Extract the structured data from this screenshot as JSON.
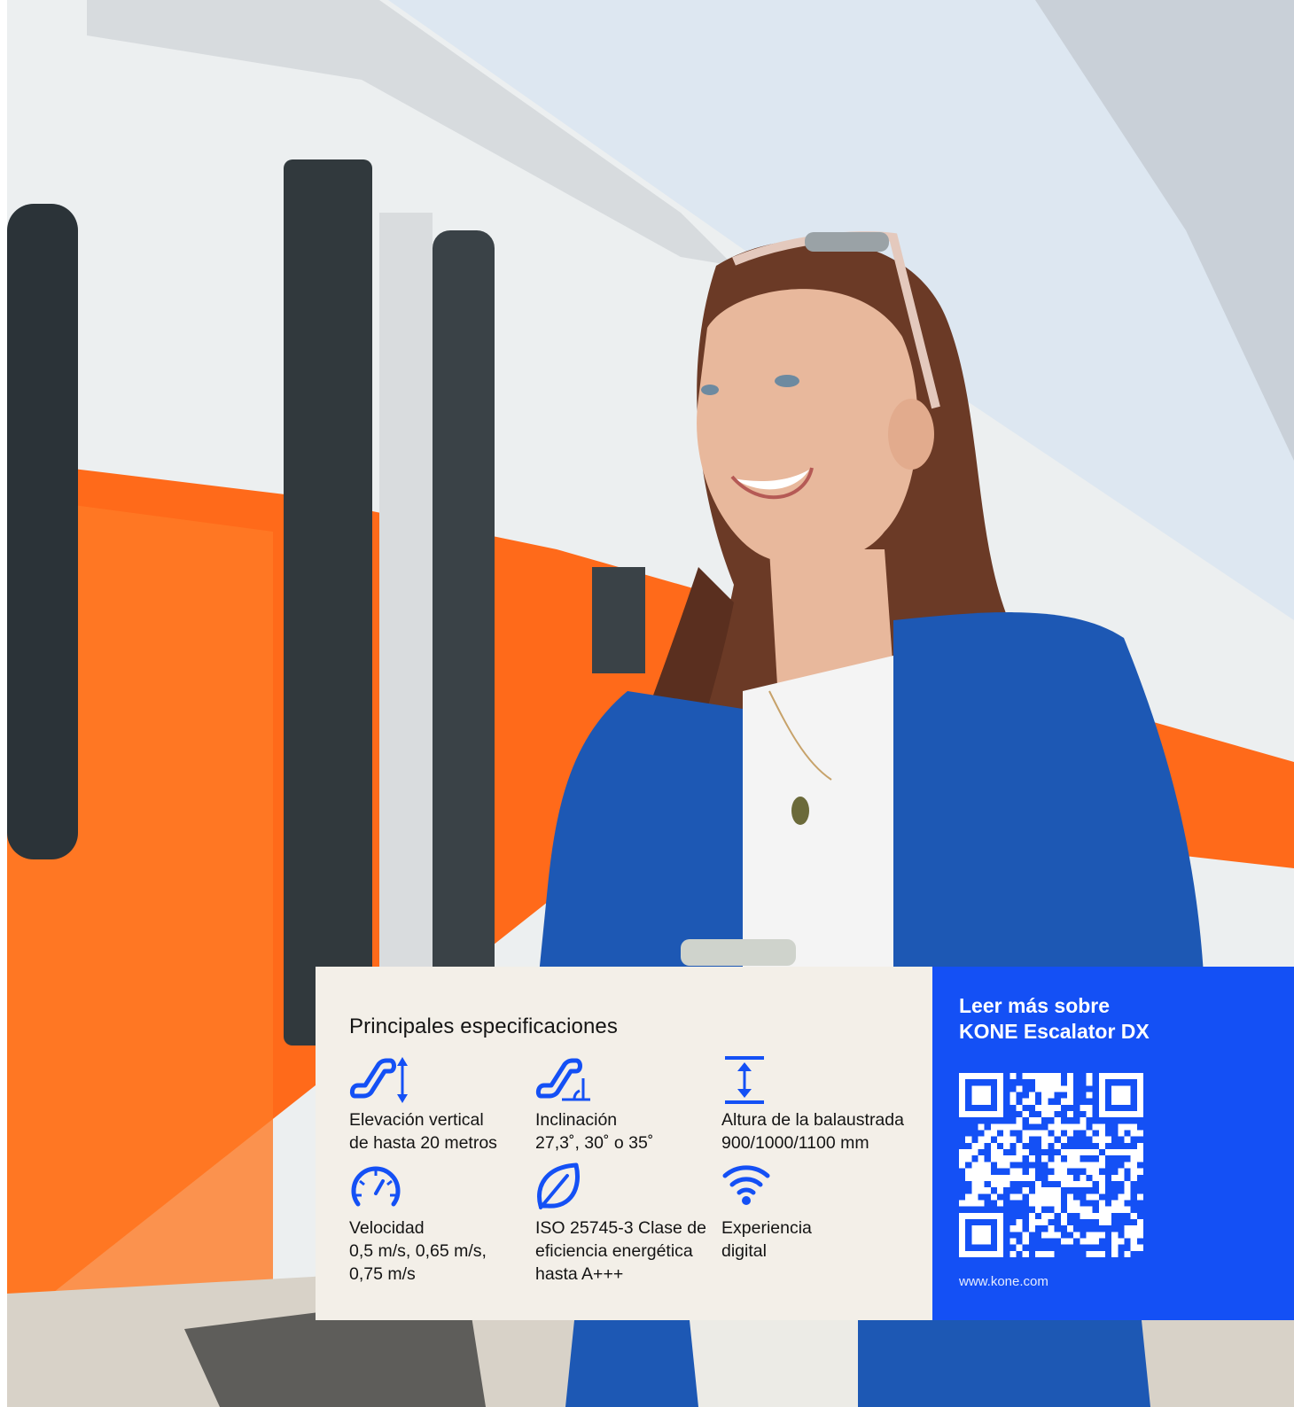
{
  "photo": {
    "description_icon": "photo-woman-train-platform",
    "colors": {
      "train_white": "#eef0f1",
      "train_orange": "#ff6a1a",
      "jacket_blue": "#1d58b4",
      "hair_brown": "#6b3a26",
      "skin": "#e8b89c"
    }
  },
  "specs": {
    "title": "Principales especificaciones",
    "items": [
      {
        "icon": "escalator-rise-icon",
        "label": "Elevación vertical",
        "value": "de hasta 20 metros"
      },
      {
        "icon": "escalator-incline-icon",
        "label": "Inclinación",
        "value": "27,3˚, 30˚ o 35˚"
      },
      {
        "icon": "balustrade-height-icon",
        "label": "Altura de la balaustrada",
        "value": "900/1000/1100 mm"
      },
      {
        "icon": "speedometer-icon",
        "label": "Velocidad",
        "value": "0,5 m/s, 0,65 m/s,",
        "value2": "0,75 m/s"
      },
      {
        "icon": "leaf-icon",
        "label": "ISO 25745-3 Clase de",
        "value": "eficiencia energética",
        "value2": "hasta A+++"
      },
      {
        "icon": "wifi-icon",
        "label": "Experiencia",
        "value": "digital"
      }
    ]
  },
  "cta": {
    "title_line1": "Leer más sobre",
    "title_line2": "KONE Escalator DX",
    "qr_icon": "qr-code",
    "url": "www.kone.com"
  },
  "colors": {
    "accent_blue": "#1450f5",
    "panel_beige": "#f3efe8",
    "text_dark": "#141414"
  }
}
